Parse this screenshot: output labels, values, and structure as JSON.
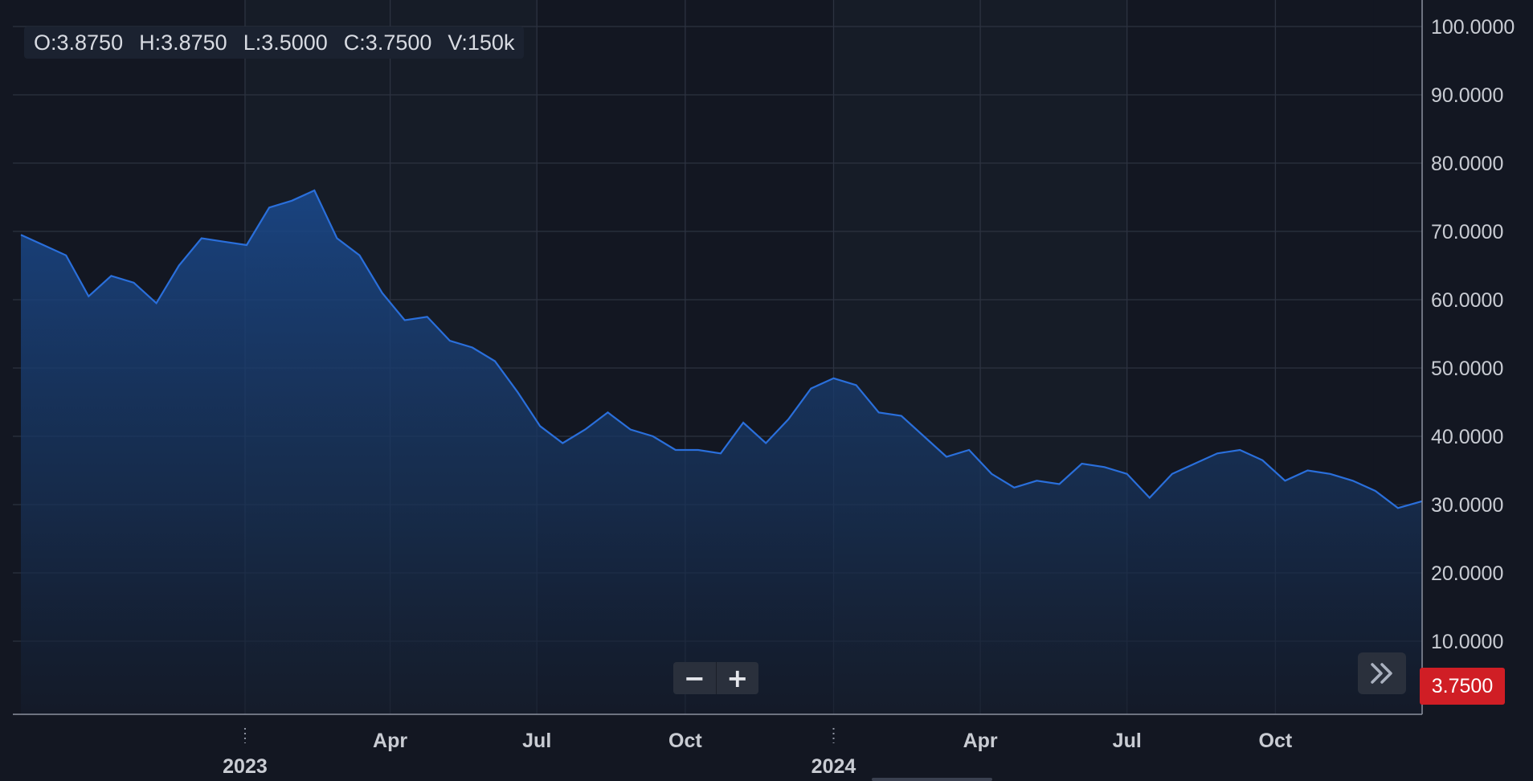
{
  "ohlc": {
    "open": "O:3.8750",
    "high": "H:3.8750",
    "low": "L:3.5000",
    "close": "C:3.7500",
    "volume": "V:150k"
  },
  "last_price": "3.7500",
  "zoom": {
    "out_label": "−",
    "in_label": "+"
  },
  "colors": {
    "background": "#131722",
    "line": "#2a6fdb",
    "grid": "#2c3240",
    "price_badge": "#d01e25"
  },
  "icons": {
    "scroll": "double-chevron-right-icon"
  },
  "chart_data": {
    "type": "area",
    "ylim": [
      0,
      100
    ],
    "yticks": [
      "10.0000",
      "20.0000",
      "30.0000",
      "40.0000",
      "50.0000",
      "60.0000",
      "70.0000",
      "80.0000",
      "90.0000",
      "100.0000"
    ],
    "xticks": [
      "2023",
      "Apr",
      "Jul",
      "Oct",
      "2024",
      "Apr",
      "Jul",
      "Oct"
    ],
    "xlim": [
      "2022-08-13",
      "2024-12-31"
    ],
    "grid": true,
    "series": [
      {
        "dates": [
          "2022-08-15",
          "2022-08-29",
          "2022-09-12",
          "2022-09-26",
          "2022-10-10",
          "2022-10-24",
          "2022-11-07",
          "2022-11-21",
          "2022-12-05",
          "2022-12-19",
          "2023-01-02",
          "2023-01-16",
          "2023-01-30",
          "2023-02-13",
          "2023-02-27",
          "2023-03-13",
          "2023-03-27",
          "2023-04-10",
          "2023-04-24",
          "2023-05-08",
          "2023-05-22",
          "2023-06-05",
          "2023-06-19",
          "2023-07-03",
          "2023-07-17",
          "2023-07-31",
          "2023-08-14",
          "2023-08-28",
          "2023-09-11",
          "2023-09-25",
          "2023-10-09",
          "2023-10-23",
          "2023-11-06",
          "2023-11-20",
          "2023-12-04",
          "2023-12-18",
          "2024-01-01",
          "2024-01-15",
          "2024-01-29",
          "2024-02-12",
          "2024-02-26",
          "2024-03-11",
          "2024-03-25",
          "2024-04-08",
          "2024-04-22",
          "2024-05-06",
          "2024-05-20",
          "2024-06-03",
          "2024-06-17",
          "2024-07-01",
          "2024-07-15",
          "2024-07-29",
          "2024-08-12",
          "2024-08-26",
          "2024-09-09",
          "2024-09-23",
          "2024-10-07",
          "2024-10-21",
          "2024-11-04",
          "2024-11-18",
          "2024-12-02",
          "2024-12-16",
          "2024-12-31"
        ],
        "values": [
          69.5,
          68.0,
          66.5,
          60.5,
          63.5,
          62.5,
          59.5,
          65.0,
          69.0,
          68.5,
          68.0,
          73.5,
          74.5,
          76.0,
          69.0,
          66.5,
          61.0,
          57.0,
          57.5,
          54.0,
          53.0,
          51.0,
          46.5,
          41.5,
          39.0,
          41.0,
          43.5,
          41.0,
          40.0,
          38.0,
          38.0,
          37.5,
          42.0,
          39.0,
          42.5,
          47.0,
          48.5,
          47.5,
          43.5,
          43.0,
          40.0,
          37.0,
          38.0,
          34.5,
          32.5,
          33.5,
          33.0,
          36.0,
          35.5,
          34.5,
          31.0,
          34.5,
          36.0,
          37.5,
          38.0,
          36.5,
          33.5,
          35.0,
          34.5,
          33.5,
          32.0,
          29.5,
          30.5
        ]
      }
    ]
  }
}
